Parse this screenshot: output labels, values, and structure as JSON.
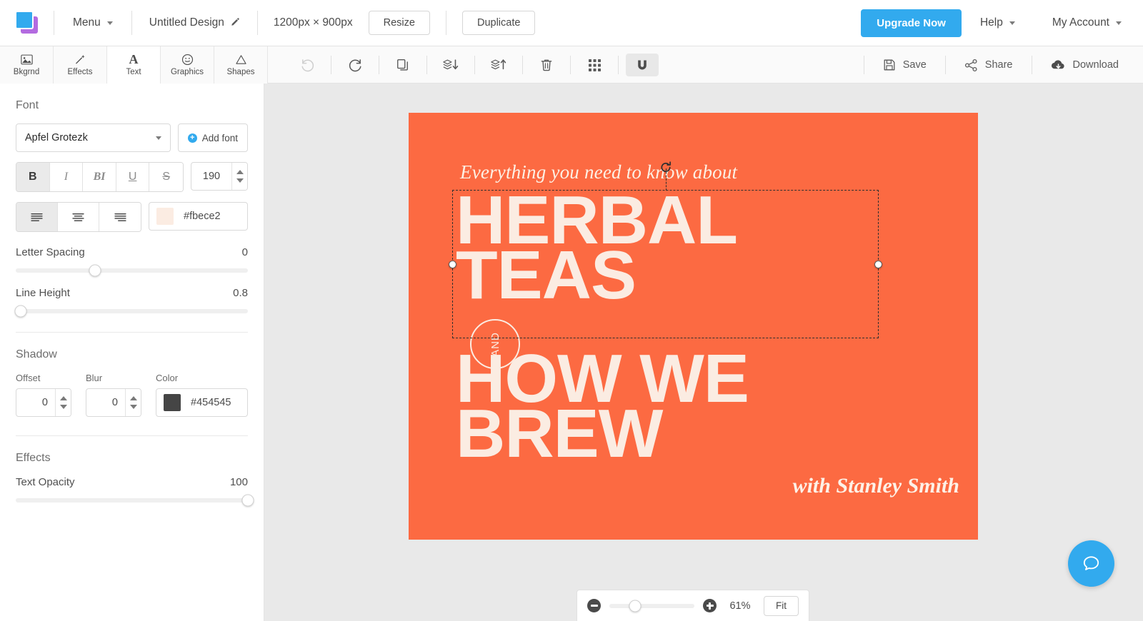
{
  "topbar": {
    "logo_icon": "app-logo-squares",
    "menu_label": "Menu",
    "doc_title": "Untitled Design",
    "edit_icon": "pencil-icon",
    "dimensions": "1200px × 900px",
    "resize_label": "Resize",
    "duplicate_label": "Duplicate",
    "upgrade_label": "Upgrade Now",
    "help_label": "Help",
    "account_label": "My Account",
    "upgrade_color": "#32aaee"
  },
  "toolbar": {
    "tabs": [
      {
        "label": "Bkgrnd",
        "icon": "image-icon",
        "active": false
      },
      {
        "label": "Effects",
        "icon": "magic-wand-icon",
        "active": false
      },
      {
        "label": "Text",
        "icon": "letter-a-icon",
        "active": true
      },
      {
        "label": "Graphics",
        "icon": "smiley-icon",
        "active": false
      },
      {
        "label": "Shapes",
        "icon": "triangle-icon",
        "active": false
      }
    ],
    "actions": [
      {
        "name": "undo",
        "icon": "undo-icon",
        "state": "disabled"
      },
      {
        "name": "redo",
        "icon": "redo-icon",
        "state": "enabled"
      },
      {
        "name": "duplicate",
        "icon": "copy-icon",
        "state": "enabled"
      },
      {
        "name": "send-backward",
        "icon": "layers-down-icon",
        "state": "enabled"
      },
      {
        "name": "bring-forward",
        "icon": "layers-up-icon",
        "state": "enabled"
      },
      {
        "name": "delete",
        "icon": "trash-icon",
        "state": "enabled"
      },
      {
        "name": "grid",
        "icon": "grid-icon",
        "state": "enabled"
      },
      {
        "name": "snap",
        "icon": "magnet-icon",
        "state": "active"
      }
    ],
    "save_label": "Save",
    "share_label": "Share",
    "download_label": "Download"
  },
  "panel": {
    "font_section_title": "Font",
    "font_family": "Apfel Grotezk",
    "add_font_label": "Add font",
    "styles": [
      {
        "label": "B",
        "name": "bold",
        "active": true
      },
      {
        "label": "I",
        "name": "italic",
        "active": false
      },
      {
        "label": "BI",
        "name": "bold-italic",
        "active": false
      },
      {
        "label": "U",
        "name": "underline",
        "active": false
      },
      {
        "label": "S",
        "name": "strikethrough",
        "active": false
      }
    ],
    "font_size": "190",
    "aligns": [
      {
        "name": "align-left",
        "icon": "align-left-icon",
        "active": true
      },
      {
        "name": "align-center",
        "icon": "align-center-icon",
        "active": false
      },
      {
        "name": "align-right",
        "icon": "align-right-icon",
        "active": false
      }
    ],
    "text_color_hex": "#fbece2",
    "letter_spacing_label": "Letter Spacing",
    "letter_spacing_value": "0",
    "letter_spacing_pct": 34,
    "line_height_label": "Line Height",
    "line_height_value": "0.8",
    "line_height_pct": 2,
    "shadow_section_title": "Shadow",
    "shadow_offset_label": "Offset",
    "shadow_offset_value": "0",
    "shadow_blur_label": "Blur",
    "shadow_blur_value": "0",
    "shadow_color_label": "Color",
    "shadow_color_hex": "#454545",
    "effects_section_title": "Effects",
    "text_opacity_label": "Text Opacity",
    "text_opacity_value": "100",
    "text_opacity_pct": 100
  },
  "artboard": {
    "background_hex": "#fc6a42",
    "text_hex": "#fbece2",
    "subtitle": "Everything you need to know about",
    "headline_line1": "HERBAL",
    "headline_line2": "TEAS",
    "badge_text": "AND",
    "headline_line3": "HOW WE",
    "headline_line4": "BREW",
    "signature": "with Stanley Smith"
  },
  "zoombar": {
    "zoom_out_icon": "minus-circle-icon",
    "zoom_in_icon": "plus-circle-icon",
    "zoom_percent": "61%",
    "zoom_slider_pct": 30,
    "fit_label": "Fit"
  },
  "help": {
    "icon": "chat-bubble-icon",
    "color": "#32aaee"
  }
}
